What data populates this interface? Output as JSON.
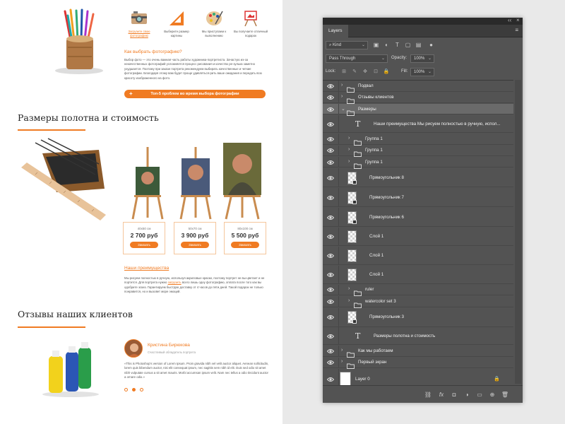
{
  "website": {
    "features": [
      {
        "label": "Загрузите свою фотографию",
        "icon": "camera-icon",
        "highlight": true
      },
      {
        "label": "Выберите размер картины",
        "icon": "ruler-triangle-icon",
        "highlight": false
      },
      {
        "label": "Мы приступаем к выполнению",
        "icon": "palette-icon",
        "highlight": false
      },
      {
        "label": "Вы получаете отличный подарок",
        "icon": "easel-icon",
        "highlight": false
      }
    ],
    "how_title": "Как выбрать фотографию?",
    "how_text": "Выбор фото — это очень важная часть работы художника-портретиста. Зачастую из-за некачественных фотографий усложняется процесс рисования и качество ре-зулька заметно ухудшается. Поэтому при заказе портрета рекомендуем выбирать качественные и четкие фотографии. Благодаря этому вам будет проще удивляться-рить ваше ожидания и передать всю красоту изображенного на фото.",
    "top5_button": "Топ-5 проблем во время выбора фотографии",
    "sizes_title": "Размеры полотна и стоимость",
    "price_cards": [
      {
        "size": "40х50 см",
        "price": "2 700 руб",
        "button": "Заказать"
      },
      {
        "size": "50х70 см",
        "price": "3 900 руб",
        "button": "Заказать"
      },
      {
        "size": "80х100 см",
        "price": "5 500 руб",
        "button": "Заказать"
      }
    ],
    "adv_title": "Наши преимущества",
    "adv_text_1": "Мы рисуем полностью в ручную, используя акриловые краски, поэтому портрет не вы-цветает и не портится. Для портрета нужно ",
    "adv_link": "загрузить",
    "adv_text_2": " всего лишь одну фотографию, оплата после того как вы одобрите эскиз. Гарантируем быструю доставку от 4 часов до пяти дней. Такой подарок не только понравится, но и вызовет море эмоций.",
    "reviews_title": "Отзывы наших клиентов",
    "reviewer_name": "Кристина Бирюкова",
    "reviewer_sub": "Счастливый обладатель портрета",
    "review_text": "«This is Photoshop's version of Lorem Ipsum. Proin gravida nibh vel velit auctor aliquet. Aenean sollicitudin, lorem quis bibendum auctor, nisi elit consequat ipsum, nec sagittis sem nibh id elit. Duis sed odio sit amet nibh vulputate cursus a sit amet mauris. Morbi accumsan ipsum velit. Nam nec tellus a odio tincidunt auctor a ornare odio.»"
  },
  "panel": {
    "tab": "Layers",
    "kind": "Kind",
    "blend": "Pass Through",
    "opacity_label": "Opacity:",
    "opacity": "100%",
    "lock_label": "Lock:",
    "fill_label": "Fill:",
    "fill": "100%",
    "layers": [
      {
        "name": "Подвал",
        "type": "group",
        "indent": 0,
        "collapsed": true
      },
      {
        "name": "Отзывы клиентов",
        "type": "group",
        "indent": 0,
        "collapsed": true
      },
      {
        "name": "Размеры",
        "type": "group",
        "indent": 0,
        "collapsed": false,
        "selected": true
      },
      {
        "name": "Наши преимущества  Мы рисуем полностью в ручную, испол...",
        "type": "text",
        "indent": 1
      },
      {
        "name": "Группа 1",
        "type": "group",
        "indent": 1,
        "collapsed": true
      },
      {
        "name": "Группа 1",
        "type": "group",
        "indent": 1,
        "collapsed": true
      },
      {
        "name": "Группа 1",
        "type": "group",
        "indent": 1,
        "collapsed": true
      },
      {
        "name": "Прямоугольник 8",
        "type": "smart",
        "indent": 1
      },
      {
        "name": "Прямоугольник 7",
        "type": "smart",
        "indent": 1
      },
      {
        "name": "Прямоугольник 6",
        "type": "smart",
        "indent": 1
      },
      {
        "name": "Слой 1",
        "type": "pixel",
        "indent": 1
      },
      {
        "name": "Слой 1",
        "type": "pixel",
        "indent": 1
      },
      {
        "name": "Слой 1",
        "type": "pixel",
        "indent": 1
      },
      {
        "name": "ruler",
        "type": "group",
        "indent": 1,
        "collapsed": true
      },
      {
        "name": "watercolor set 3",
        "type": "group",
        "indent": 1,
        "collapsed": true
      },
      {
        "name": "Прямоугольник 3",
        "type": "smart",
        "indent": 1
      },
      {
        "name": "Размеры полотна и стоимость",
        "type": "text",
        "indent": 1
      },
      {
        "name": "Как мы работаем",
        "type": "group",
        "indent": 0,
        "collapsed": true
      },
      {
        "name": "Первый экран",
        "type": "group",
        "indent": 0,
        "collapsed": true
      },
      {
        "name": "Layer 0",
        "type": "background",
        "indent": 0,
        "locked": true
      }
    ]
  },
  "colors": {
    "accent": "#f07b22",
    "panel_bg": "#535353",
    "panel_dark": "#2a2a2a"
  }
}
